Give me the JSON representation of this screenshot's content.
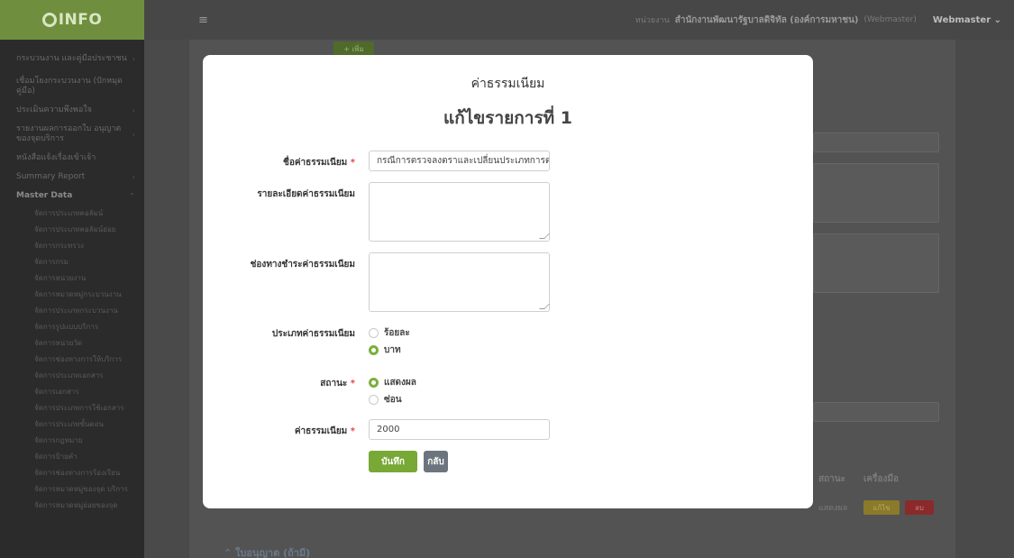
{
  "app": {
    "logo_text": "INFO"
  },
  "topbar": {
    "menu_icon": "hamburger-icon",
    "agency_prefix": "หน่วยงาน",
    "agency_name": "สำนักงานพัฒนารัฐบาลดิจิทัล (องค์การมหาชน)",
    "role": "(Webmaster)",
    "user": "Webmaster"
  },
  "sidebar": {
    "items": [
      {
        "label": "กระบวนงาน และคู่มือประชาชน",
        "chevron": "›"
      },
      {
        "label": "เชื่อมโยงกระบวนงาน (ปักหมุดคู่มือ)",
        "chevron": ""
      },
      {
        "label": "ประเมินความพึงพอใจ",
        "chevron": "›"
      },
      {
        "label": "รายงานผลการออกใบ อนุญาตของจุดบริการ",
        "chevron": "›"
      },
      {
        "label": "หนังสือแจ้งเรื่องเข้าเจ้า",
        "chevron": ""
      },
      {
        "label": "Summary Report",
        "chevron": "›"
      },
      {
        "label": "Master Data",
        "chevron": "⌃"
      }
    ],
    "sub_items": [
      "จัดการประเภทคอลัมน์",
      "จัดการประเภทคอลัมน์ย่อย",
      "จัดการกระทรวง",
      "จัดการกรม",
      "จัดการหน่วยงาน",
      "จัดการหมวดหมู่กระบวนงาน",
      "จัดการประเภทกระบวนงาน",
      "จัดการรูปแบบบริการ",
      "จัดการหน่วยวัด",
      "จัดการช่องทางการให้บริการ",
      "จัดการประเภทเอกสาร",
      "จัดการเอกสาร",
      "จัดการประเภทการใช้เอกสาร",
      "จัดการประเภทขั้นตอน",
      "จัดการกฎหมาย",
      "จัดการป้ายคำ",
      "จัดการช่องทางการร้องเรียน",
      "จัดการหมวดหมู่ของจุด บริการ",
      "จัดการหมวดหมู่ย่อยของจุด"
    ]
  },
  "background": {
    "add_button": "+ เพิ่ม",
    "table_header_status": "สถานะ",
    "table_header_tools": "เครื่องมือ",
    "row_status": "แสดงผล",
    "edit_button": "แก้ไข",
    "delete_button": "ลบ",
    "license_section": "ใบอนุญาต (ถ้ามี)"
  },
  "modal": {
    "title": "ค่าธรรมเนียม",
    "subtitle": "แก้ไขรายการที่ 1",
    "fee_name_label": "ชื่อค่าธรรมเนียม",
    "fee_name_value": "กรณีการตรวจลงตราและเปลี่ยนประเภทการตรวจลงตรา",
    "fee_detail_label": "รายละเอียดค่าธรรมเนียม",
    "payment_channel_label": "ช่องทางชำระค่าธรรมเนียม",
    "fee_type_label": "ประเภทค่าธรรมเนียม",
    "fee_type_options": [
      "ร้อยละ",
      "บาท"
    ],
    "fee_type_selected": "บาท",
    "status_label": "สถานะ",
    "status_options": [
      "แสดงผล",
      "ซ่อน"
    ],
    "status_selected": "แสดงผล",
    "fee_amount_label": "ค่าธรรมเนียม",
    "fee_amount_value": "2000",
    "required_mark": "*",
    "save_button": "บันทึก",
    "back_button": "กลับ"
  },
  "colors": {
    "accent": "#78a835",
    "secondary": "#6c757d",
    "required": "#e04848"
  }
}
